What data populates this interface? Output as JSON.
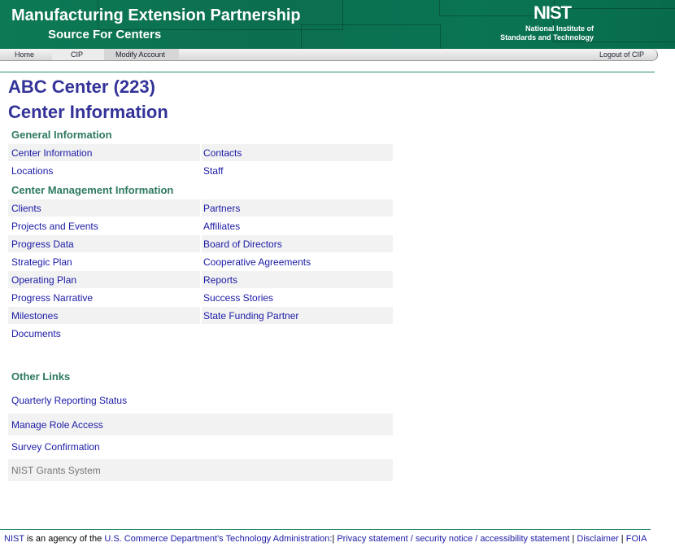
{
  "header": {
    "title": "Manufacturing Extension Partnership",
    "subtitle": "Source For Centers",
    "logo": "NIST",
    "logo_line1": "National Institute of",
    "logo_line2": "Standards and Technology"
  },
  "nav": {
    "items": [
      "Home",
      "CIP",
      "Modify Account"
    ],
    "logout": "Logout of CIP"
  },
  "page": {
    "center": "ABC Center (223)",
    "title": "Center Information"
  },
  "general": {
    "heading": "General Information",
    "rows": [
      [
        "Center Information",
        "Contacts"
      ],
      [
        "Locations",
        "Staff"
      ]
    ]
  },
  "management": {
    "heading": "Center Management Information",
    "rows": [
      [
        "Clients",
        "Partners"
      ],
      [
        "Projects and Events",
        "Affiliates"
      ],
      [
        "Progress Data",
        "Board of Directors"
      ],
      [
        "Strategic Plan",
        "Cooperative Agreements"
      ],
      [
        "Operating Plan",
        "Reports"
      ],
      [
        "Progress Narrative",
        "Success Stories"
      ],
      [
        "Milestones",
        "State Funding Partner"
      ],
      [
        "Documents",
        ""
      ]
    ]
  },
  "other": {
    "heading": "Other Links",
    "links": [
      "Quarterly Reporting Status",
      "Manage Role Access",
      "Survey Confirmation",
      "NIST Grants System"
    ]
  },
  "footer": {
    "nist": "NIST",
    "text1": " is an agency of the ",
    "commerce": "U.S. Commerce Department's Technology Administration:",
    "sep": "| ",
    "privacy": "Privacy statement / security notice / accessibility statement",
    "disclaimer": "Disclaimer",
    "foia": "FOIA"
  }
}
